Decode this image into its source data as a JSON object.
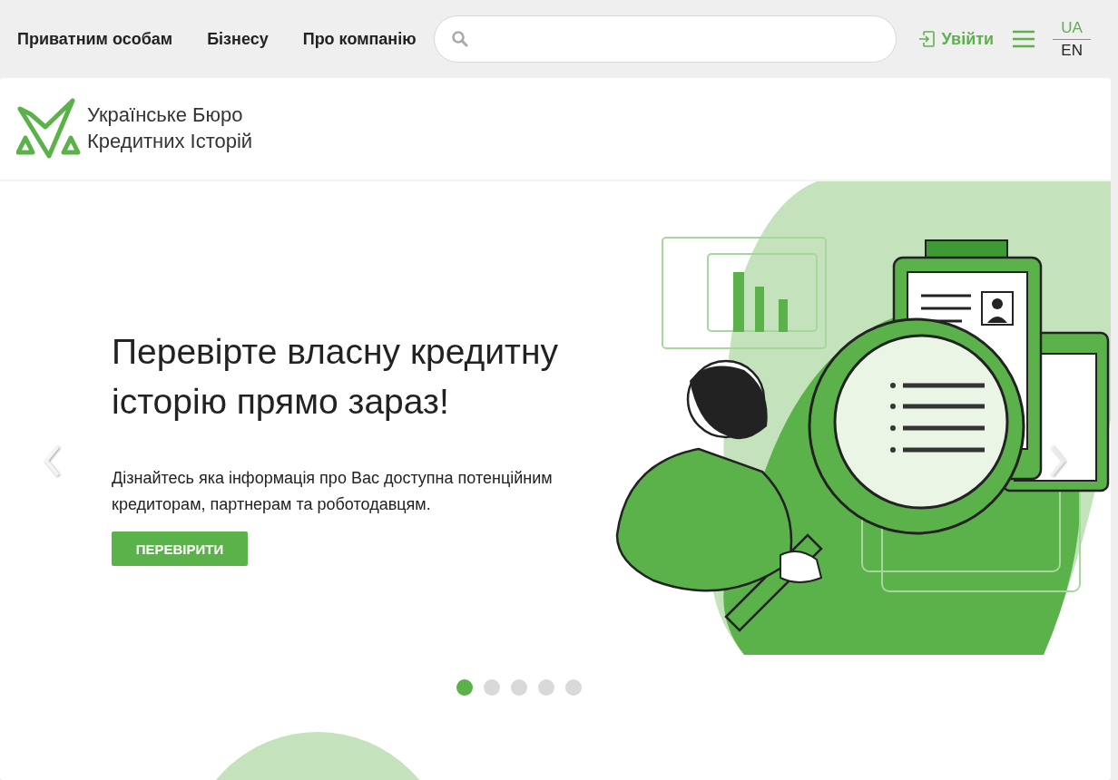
{
  "nav": {
    "links": [
      "Приватним особам",
      "Бізнесу",
      "Про компанію"
    ],
    "login": "Увійти",
    "languages": [
      {
        "label": "UA",
        "selected": true
      },
      {
        "label": "EN",
        "selected": false
      }
    ]
  },
  "logo": {
    "line_1": "Українське Бюро",
    "line_2": "Кредитних Історій"
  },
  "hero": {
    "title": "Перевірте власну кредитну історію прямо зараз!",
    "text": "Дізнайтесь яка інформація про Вас доступна потенційним кредиторам, партнерам та роботодавцям.",
    "button": "ПЕРЕВІРИТИ"
  },
  "slides": [
    {
      "selected": true
    },
    {
      "selected": false
    },
    {
      "selected": false
    },
    {
      "selected": false
    },
    {
      "selected": false
    }
  ]
}
